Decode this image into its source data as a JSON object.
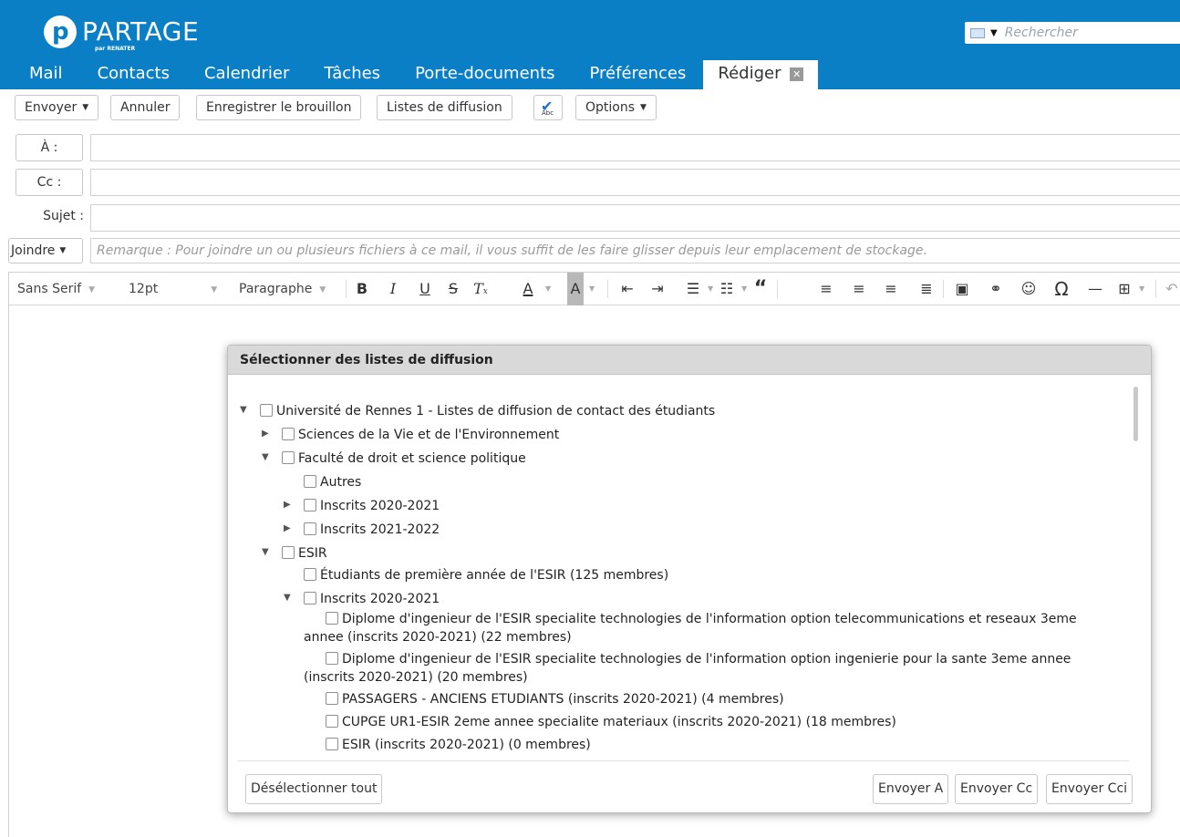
{
  "app": {
    "logo_text": "PARTAGE",
    "logo_sub": "par RENATER"
  },
  "search": {
    "placeholder": "Rechercher"
  },
  "nav": {
    "tabs": [
      "Mail",
      "Contacts",
      "Calendrier",
      "Tâches",
      "Porte-documents",
      "Préférences"
    ],
    "active_tab": "Rédiger"
  },
  "toolbar": {
    "send": "Envoyer",
    "cancel": "Annuler",
    "save_draft": "Enregistrer le brouillon",
    "lists": "Listes de diffusion",
    "spell_abc": "Abc",
    "options": "Options"
  },
  "compose": {
    "to_label": "À :",
    "cc_label": "Cc :",
    "subject_label": "Sujet :",
    "attach_label": "Joindre",
    "attach_hint": "Remarque : Pour joindre un ou plusieurs fichiers à ce mail, il vous suffit de les faire glisser depuis leur emplacement de stockage."
  },
  "editor": {
    "font": "Sans Serif",
    "size": "12pt",
    "block": "Paragraphe"
  },
  "dialog": {
    "title": "Sélectionner des listes de diffusion",
    "items": [
      {
        "label": "Université de Rennes 1 - Listes de diffusion de contact des étudiants",
        "state": "expanded"
      },
      {
        "label": "Sciences de la Vie et de l'Environnement",
        "state": "collapsed"
      },
      {
        "label": "Faculté de droit et science politique",
        "state": "expanded"
      },
      {
        "label": "Autres",
        "state": "leaf"
      },
      {
        "label": "Inscrits 2020-2021",
        "state": "collapsed"
      },
      {
        "label": "Inscrits 2021-2022",
        "state": "collapsed"
      },
      {
        "label": "ESIR",
        "state": "expanded"
      },
      {
        "label": "Étudiants de première année de l'ESIR (125 membres)",
        "state": "leaf"
      },
      {
        "label": "Inscrits 2020-2021",
        "state": "expanded"
      },
      {
        "label_line1": "Diplome d'ingenieur de l'ESIR specialite technologies de l'information option telecommunications et reseaux 3eme",
        "label_line2": "annee (inscrits 2020-2021) (22 membres)",
        "state": "leaf"
      },
      {
        "label_line1": "Diplome d'ingenieur de l'ESIR specialite technologies de l'information option ingenierie pour la sante 3eme annee",
        "label_line2": "(inscrits 2020-2021) (20 membres)",
        "state": "leaf"
      },
      {
        "label": "PASSAGERS - ANCIENS ETUDIANTS (inscrits 2020-2021) (4 membres)",
        "state": "leaf"
      },
      {
        "label": "CUPGE UR1-ESIR 2eme annee specialite materiaux (inscrits 2020-2021) (18 membres)",
        "state": "leaf"
      },
      {
        "label": "ESIR (inscrits 2020-2021) (0 membres)",
        "state": "leaf"
      }
    ],
    "deselect_all": "Désélectionner tout",
    "send_to": "Envoyer A",
    "send_cc": "Envoyer Cc",
    "send_bcc": "Envoyer Cci"
  },
  "colors": {
    "brand": "#0a7fc6",
    "dialog_header": "#d9d9d9"
  }
}
